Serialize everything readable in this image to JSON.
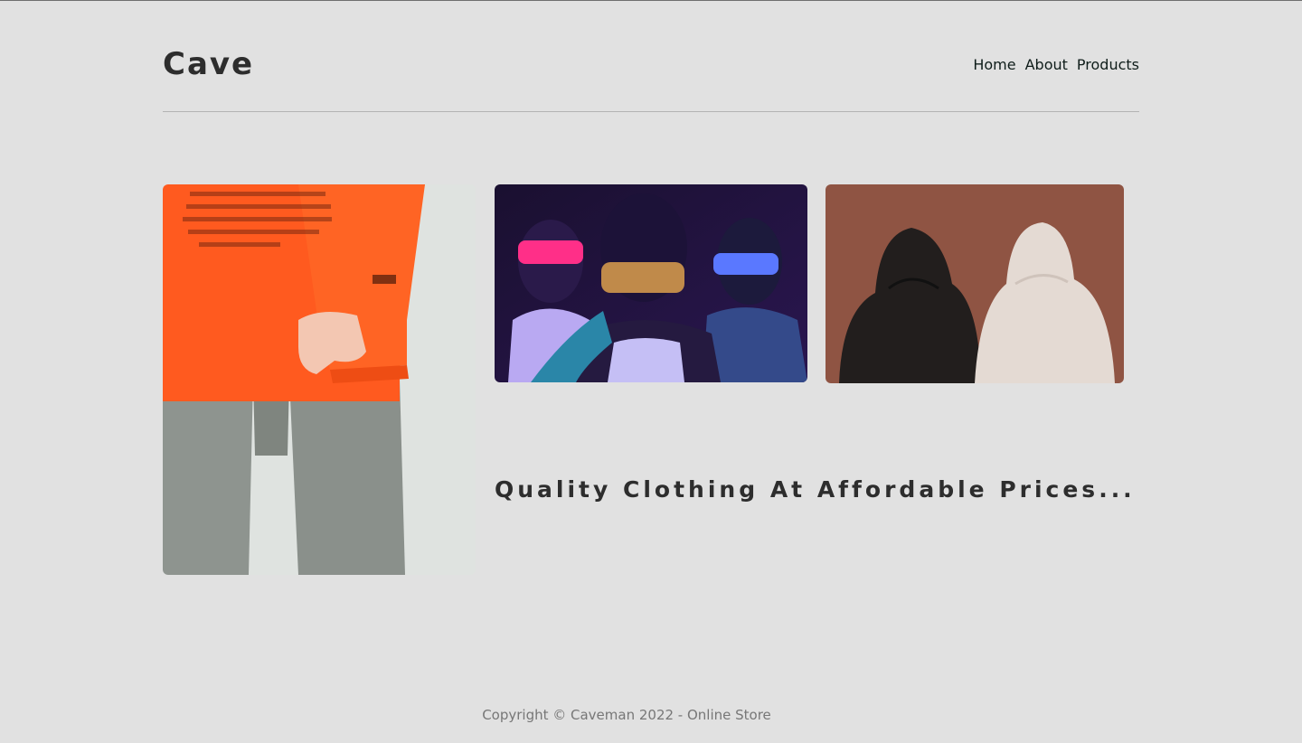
{
  "header": {
    "logo": "Cave",
    "nav": [
      {
        "label": "Home"
      },
      {
        "label": "About"
      },
      {
        "label": "Products"
      }
    ]
  },
  "hero": {
    "tagline": "Quality Clothing At Affordable Prices...",
    "images": [
      {
        "name": "orange-shirt-photo"
      },
      {
        "name": "blindfolded-group-photo"
      },
      {
        "name": "hoodies-photo"
      }
    ]
  },
  "footer": {
    "copyright": "Copyright © Caveman 2022 - Online Store"
  },
  "colors": {
    "background": "#e1e1e1",
    "text": "#2d2d2d",
    "nav_text": "#0f1d1a",
    "footer_text": "#777777"
  }
}
